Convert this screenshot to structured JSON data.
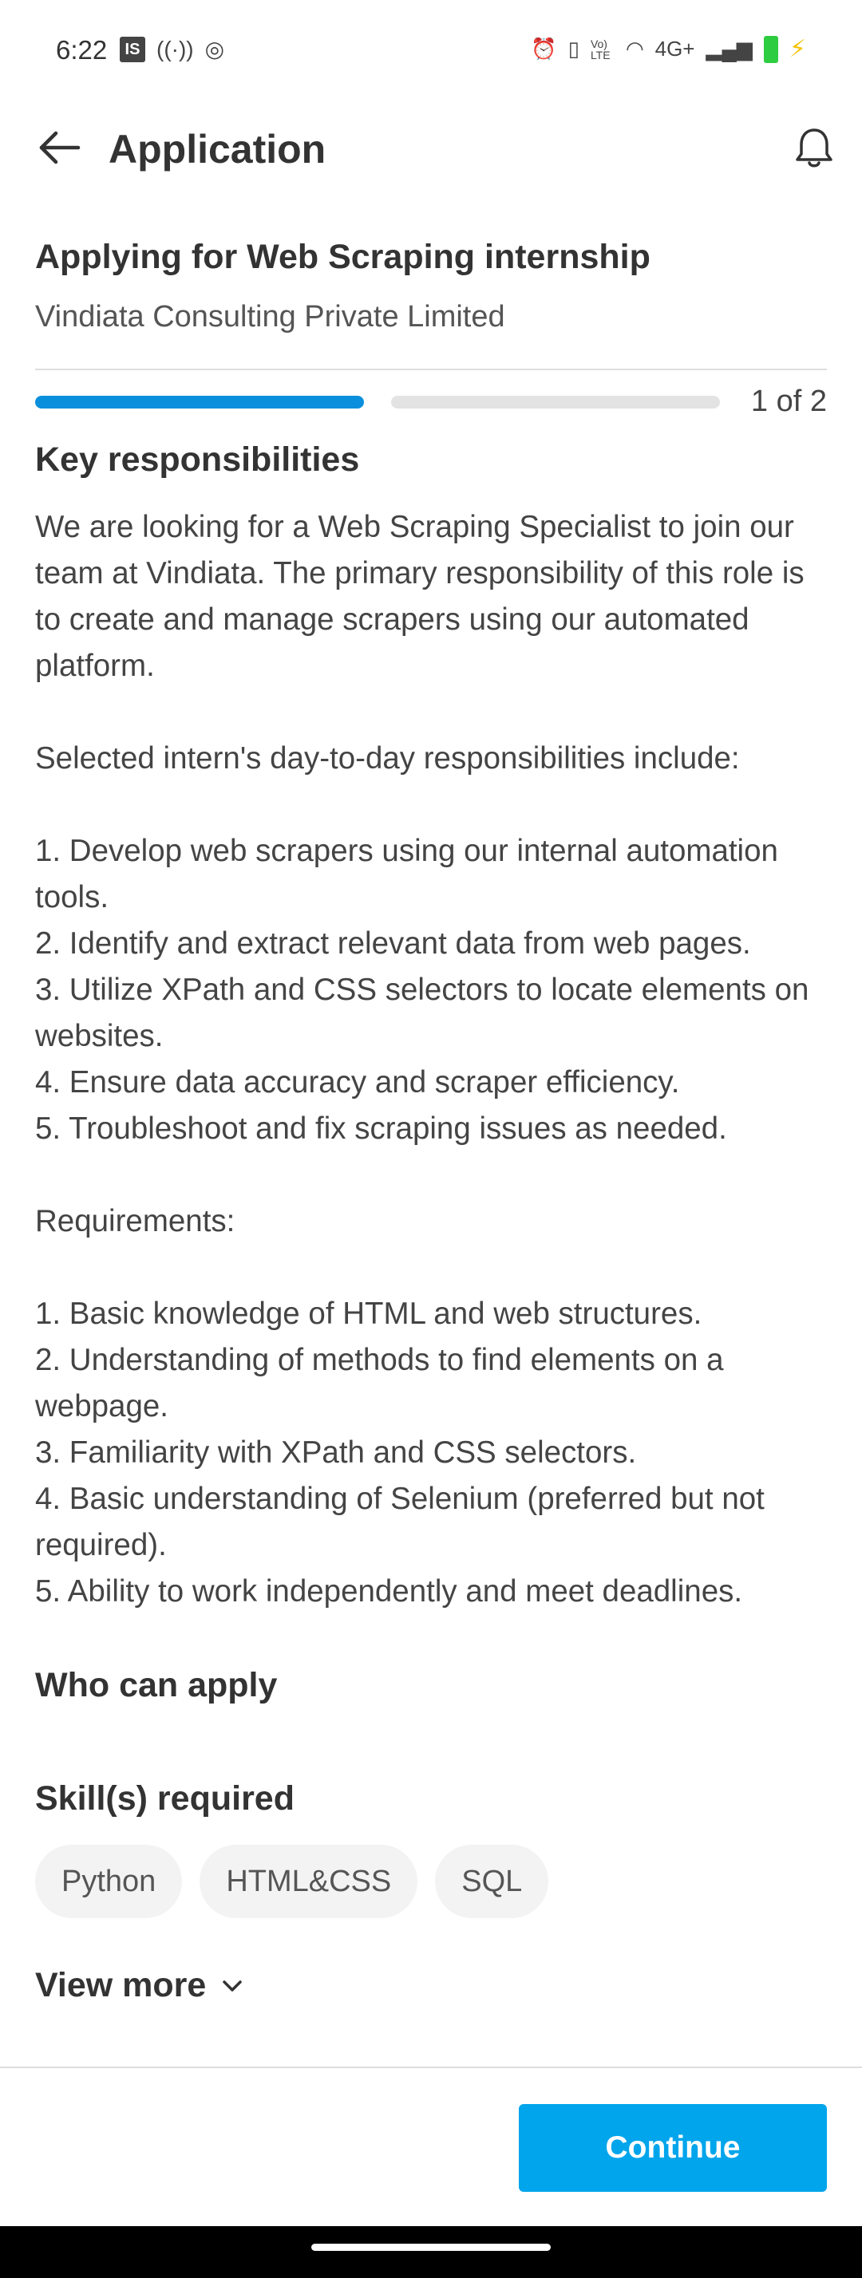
{
  "status_bar": {
    "time": "6:22",
    "left_badge": "IS",
    "network": "4G+",
    "volte": "Vo) LTE"
  },
  "app_bar": {
    "title": "Application"
  },
  "job": {
    "title": "Applying for Web Scraping internship",
    "company": "Vindiata Consulting Private Limited"
  },
  "progress": {
    "label": "1 of 2",
    "current_step": 1,
    "total_steps": 2,
    "active_color": "#0a8fdc",
    "inactive_color": "#e3e3e3"
  },
  "sections": {
    "key_responsibilities": "Key responsibilities",
    "who_can_apply": "Who can apply",
    "skills_required": "Skill(s) required"
  },
  "description": "We are looking for a Web Scraping Specialist to join our team at Vindiata. The primary responsibility of this role is to create and manage scrapers using our automated platform.\n\nSelected intern's day-to-day responsibilities include:\n\n1. Develop web scrapers using our internal automation tools.\n2. Identify and extract relevant data from web pages.\n3. Utilize XPath and CSS selectors to locate elements on websites.\n4. Ensure data accuracy and scraper efficiency.\n5. Troubleshoot and fix scraping issues as needed.\n\nRequirements:\n\n1. Basic knowledge of HTML and web structures.\n2. Understanding of methods to find elements on a webpage.\n3. Familiarity with XPath and CSS selectors.\n4. Basic understanding of Selenium (preferred but not required).\n5. Ability to work independently and meet deadlines.",
  "skills": [
    "Python",
    "HTML&CSS",
    "SQL"
  ],
  "view_more": "View more",
  "continue_button": "Continue",
  "colors": {
    "primary_button": "#00a5ec",
    "text_primary": "#333333"
  }
}
